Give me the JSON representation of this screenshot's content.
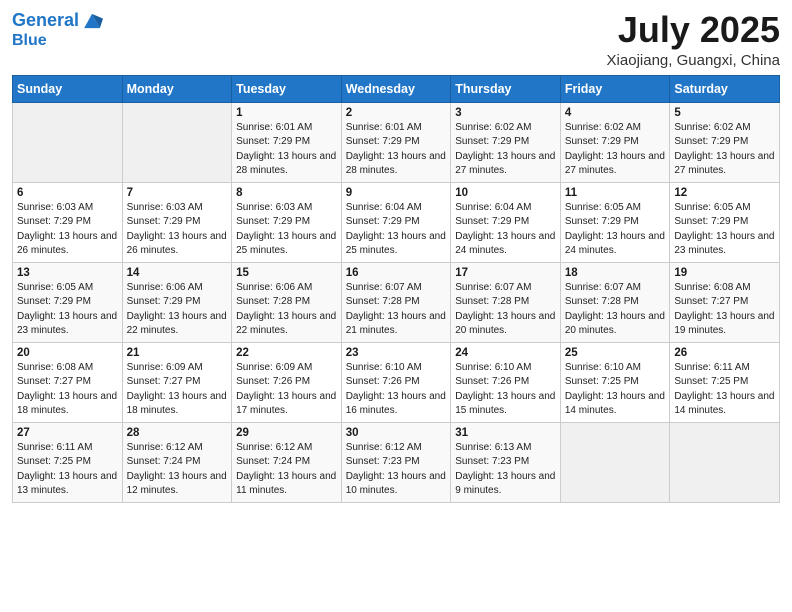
{
  "logo": {
    "line1": "General",
    "line2": "Blue"
  },
  "title": "July 2025",
  "subtitle": "Xiaojiang, Guangxi, China",
  "weekdays": [
    "Sunday",
    "Monday",
    "Tuesday",
    "Wednesday",
    "Thursday",
    "Friday",
    "Saturday"
  ],
  "weeks": [
    [
      {
        "day": "",
        "empty": true
      },
      {
        "day": "",
        "empty": true
      },
      {
        "day": "1",
        "sunrise": "6:01 AM",
        "sunset": "7:29 PM",
        "daylight": "13 hours and 28 minutes."
      },
      {
        "day": "2",
        "sunrise": "6:01 AM",
        "sunset": "7:29 PM",
        "daylight": "13 hours and 28 minutes."
      },
      {
        "day": "3",
        "sunrise": "6:02 AM",
        "sunset": "7:29 PM",
        "daylight": "13 hours and 27 minutes."
      },
      {
        "day": "4",
        "sunrise": "6:02 AM",
        "sunset": "7:29 PM",
        "daylight": "13 hours and 27 minutes."
      },
      {
        "day": "5",
        "sunrise": "6:02 AM",
        "sunset": "7:29 PM",
        "daylight": "13 hours and 27 minutes."
      }
    ],
    [
      {
        "day": "6",
        "sunrise": "6:03 AM",
        "sunset": "7:29 PM",
        "daylight": "13 hours and 26 minutes."
      },
      {
        "day": "7",
        "sunrise": "6:03 AM",
        "sunset": "7:29 PM",
        "daylight": "13 hours and 26 minutes."
      },
      {
        "day": "8",
        "sunrise": "6:03 AM",
        "sunset": "7:29 PM",
        "daylight": "13 hours and 25 minutes."
      },
      {
        "day": "9",
        "sunrise": "6:04 AM",
        "sunset": "7:29 PM",
        "daylight": "13 hours and 25 minutes."
      },
      {
        "day": "10",
        "sunrise": "6:04 AM",
        "sunset": "7:29 PM",
        "daylight": "13 hours and 24 minutes."
      },
      {
        "day": "11",
        "sunrise": "6:05 AM",
        "sunset": "7:29 PM",
        "daylight": "13 hours and 24 minutes."
      },
      {
        "day": "12",
        "sunrise": "6:05 AM",
        "sunset": "7:29 PM",
        "daylight": "13 hours and 23 minutes."
      }
    ],
    [
      {
        "day": "13",
        "sunrise": "6:05 AM",
        "sunset": "7:29 PM",
        "daylight": "13 hours and 23 minutes."
      },
      {
        "day": "14",
        "sunrise": "6:06 AM",
        "sunset": "7:29 PM",
        "daylight": "13 hours and 22 minutes."
      },
      {
        "day": "15",
        "sunrise": "6:06 AM",
        "sunset": "7:28 PM",
        "daylight": "13 hours and 22 minutes."
      },
      {
        "day": "16",
        "sunrise": "6:07 AM",
        "sunset": "7:28 PM",
        "daylight": "13 hours and 21 minutes."
      },
      {
        "day": "17",
        "sunrise": "6:07 AM",
        "sunset": "7:28 PM",
        "daylight": "13 hours and 20 minutes."
      },
      {
        "day": "18",
        "sunrise": "6:07 AM",
        "sunset": "7:28 PM",
        "daylight": "13 hours and 20 minutes."
      },
      {
        "day": "19",
        "sunrise": "6:08 AM",
        "sunset": "7:27 PM",
        "daylight": "13 hours and 19 minutes."
      }
    ],
    [
      {
        "day": "20",
        "sunrise": "6:08 AM",
        "sunset": "7:27 PM",
        "daylight": "13 hours and 18 minutes."
      },
      {
        "day": "21",
        "sunrise": "6:09 AM",
        "sunset": "7:27 PM",
        "daylight": "13 hours and 18 minutes."
      },
      {
        "day": "22",
        "sunrise": "6:09 AM",
        "sunset": "7:26 PM",
        "daylight": "13 hours and 17 minutes."
      },
      {
        "day": "23",
        "sunrise": "6:10 AM",
        "sunset": "7:26 PM",
        "daylight": "13 hours and 16 minutes."
      },
      {
        "day": "24",
        "sunrise": "6:10 AM",
        "sunset": "7:26 PM",
        "daylight": "13 hours and 15 minutes."
      },
      {
        "day": "25",
        "sunrise": "6:10 AM",
        "sunset": "7:25 PM",
        "daylight": "13 hours and 14 minutes."
      },
      {
        "day": "26",
        "sunrise": "6:11 AM",
        "sunset": "7:25 PM",
        "daylight": "13 hours and 14 minutes."
      }
    ],
    [
      {
        "day": "27",
        "sunrise": "6:11 AM",
        "sunset": "7:25 PM",
        "daylight": "13 hours and 13 minutes."
      },
      {
        "day": "28",
        "sunrise": "6:12 AM",
        "sunset": "7:24 PM",
        "daylight": "13 hours and 12 minutes."
      },
      {
        "day": "29",
        "sunrise": "6:12 AM",
        "sunset": "7:24 PM",
        "daylight": "13 hours and 11 minutes."
      },
      {
        "day": "30",
        "sunrise": "6:12 AM",
        "sunset": "7:23 PM",
        "daylight": "13 hours and 10 minutes."
      },
      {
        "day": "31",
        "sunrise": "6:13 AM",
        "sunset": "7:23 PM",
        "daylight": "13 hours and 9 minutes."
      },
      {
        "day": "",
        "empty": true
      },
      {
        "day": "",
        "empty": true
      }
    ]
  ],
  "labels": {
    "sunrise": "Sunrise:",
    "sunset": "Sunset:",
    "daylight": "Daylight:"
  }
}
